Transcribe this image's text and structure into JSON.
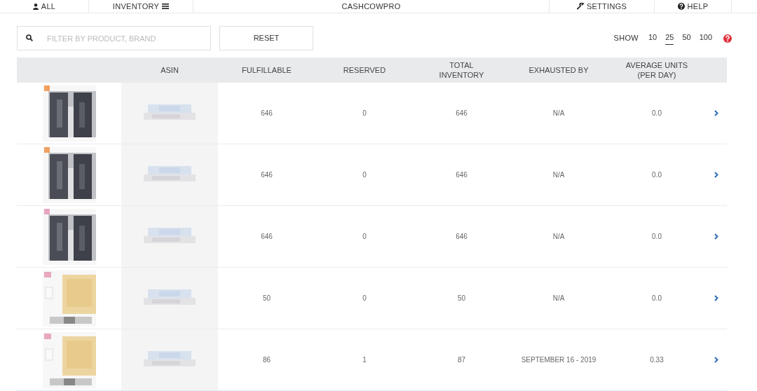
{
  "nav": {
    "items": [
      {
        "label": "ALL"
      },
      {
        "label": "INVENTORY"
      }
    ],
    "brand": "CASHCOWPRO",
    "right_items": [
      {
        "label": "SETTINGS"
      },
      {
        "label": "HELP"
      }
    ]
  },
  "toolbar": {
    "search": {
      "placeholder": "FILTER BY PRODUCT, BRAND"
    },
    "reset": "RESET",
    "show_label": "SHOW",
    "page_sizes": [
      {
        "label": "10",
        "selected": false
      },
      {
        "label": "25",
        "selected": true
      },
      {
        "label": "50",
        "selected": false
      },
      {
        "label": "100",
        "selected": false
      }
    ]
  },
  "table": {
    "columns": [
      "ASIN",
      "FULFILLABLE",
      "RESERVED",
      "TOTAL INVENTORY",
      "EXHAUSTED BY",
      "AVERAGE UNITS (PER DAY)"
    ],
    "rows": [
      {
        "fulfillable": "646",
        "reserved": "0",
        "total": "646",
        "exhausted_by": "N/A",
        "average": "0.0"
      },
      {
        "fulfillable": "646",
        "reserved": "0",
        "total": "646",
        "exhausted_by": "N/A",
        "average": "0.0"
      },
      {
        "fulfillable": "646",
        "reserved": "0",
        "total": "646",
        "exhausted_by": "N/A",
        "average": "0.0"
      },
      {
        "fulfillable": "50",
        "reserved": "0",
        "total": "50",
        "exhausted_by": "N/A",
        "average": "0.0"
      },
      {
        "fulfillable": "86",
        "reserved": "1",
        "total": "87",
        "exhausted_by": "SEPTEMBER 16 - 2019",
        "average": "0.33"
      }
    ]
  }
}
